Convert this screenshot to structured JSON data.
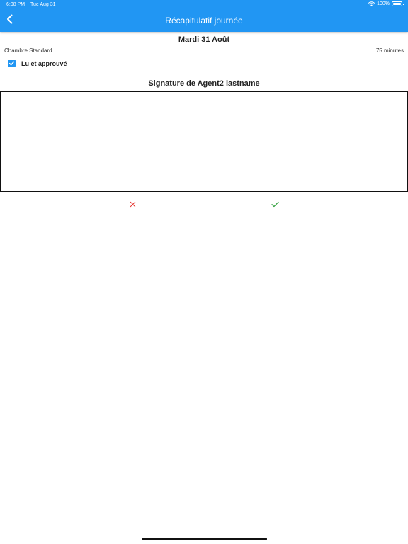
{
  "status_bar": {
    "time": "6:08 PM",
    "date": "Tue Aug 31",
    "battery": "100%",
    "wifi_icon": "wifi-icon",
    "battery_icon": "battery-icon"
  },
  "app_bar": {
    "title": "Récapitulatif journée",
    "back_icon": "chevron-left-icon",
    "background_color": "#2196F3"
  },
  "summary": {
    "date": "Mardi 31 Août",
    "room_type": "Chambre Standard",
    "duration": "75 minutes"
  },
  "approval": {
    "checked": true,
    "label": "Lu et approuvé",
    "checkbox_color": "#2196F3"
  },
  "signature": {
    "title": "Signature de Agent2 lastname"
  },
  "actions": {
    "clear_icon": "close-icon",
    "clear_color": "#E53935",
    "confirm_icon": "check-icon",
    "confirm_color": "#2E9E3A"
  }
}
